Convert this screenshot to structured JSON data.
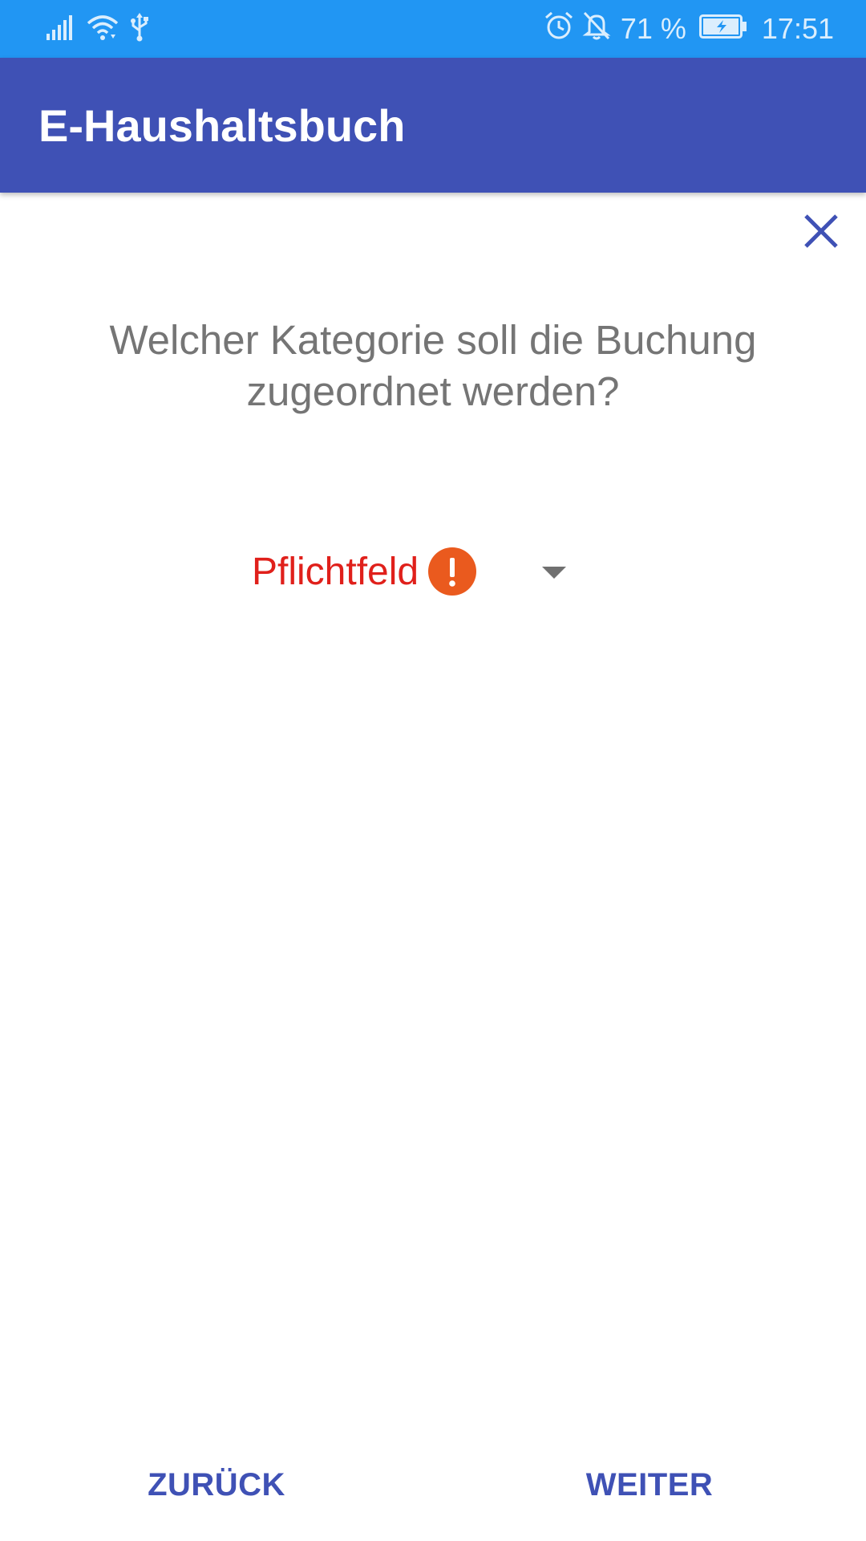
{
  "status_bar": {
    "battery_percent": "71 %",
    "time": "17:51",
    "icons": [
      "signal-icon",
      "wifi-icon",
      "usb-icon",
      "alarm-icon",
      "notifications-off-icon",
      "battery-charging-icon"
    ]
  },
  "app_bar": {
    "title": "E-Haushaltsbuch",
    "color": "#3f51b5"
  },
  "dialog": {
    "close_icon": "close-icon",
    "question": "Welcher Kategorie soll die Buchung zugeordnet werden?",
    "category_spinner": {
      "value": "Pflichtfeld",
      "error_icon": "error-icon",
      "dropdown_icon": "arrow-drop-down-icon",
      "error_color": "#e0201b"
    }
  },
  "footer": {
    "back_label": "ZURÜCK",
    "next_label": "WEITER"
  },
  "colors": {
    "status_bar": "#2196f3",
    "primary": "#3f51b5",
    "error_badge": "#ea5a1e"
  }
}
